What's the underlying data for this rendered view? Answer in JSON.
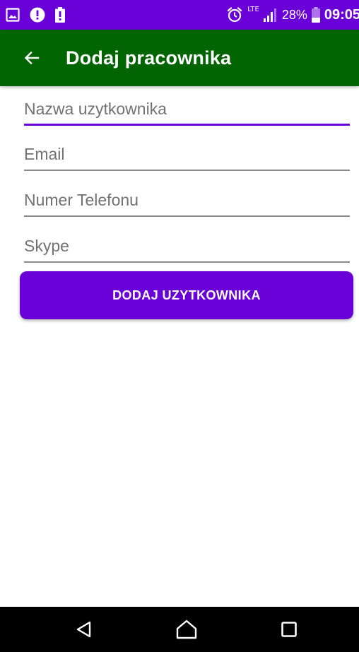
{
  "status_bar": {
    "left_icons": [
      "image-notification-icon",
      "alert-circle-icon",
      "battery-alert-icon"
    ],
    "alarm_icon": "alarm-clock-icon",
    "network_label": "LTE",
    "signal_icon": "signal-strength-icon",
    "battery_percent": "28%",
    "battery_icon": "battery-icon",
    "time": "09:05",
    "background_color": "#6a00d8"
  },
  "toolbar": {
    "back_icon": "arrow-back-icon",
    "title": "Dodaj pracownika",
    "background_color": "#006400"
  },
  "form": {
    "fields": [
      {
        "name": "username-field",
        "placeholder": "Nazwa uzytkownika",
        "value": "",
        "focused": true
      },
      {
        "name": "email-field",
        "placeholder": "Email",
        "value": "",
        "focused": false
      },
      {
        "name": "phone-field",
        "placeholder": "Numer Telefonu",
        "value": "",
        "focused": false
      },
      {
        "name": "skype-field",
        "placeholder": "Skype",
        "value": "",
        "focused": false
      }
    ],
    "submit_label": "DODAJ UZYTKOWNIKA",
    "accent_color": "#6a00d8"
  },
  "nav_bar": {
    "back_icon": "nav-back-icon",
    "home_icon": "nav-home-icon",
    "recents_icon": "nav-recents-icon"
  }
}
